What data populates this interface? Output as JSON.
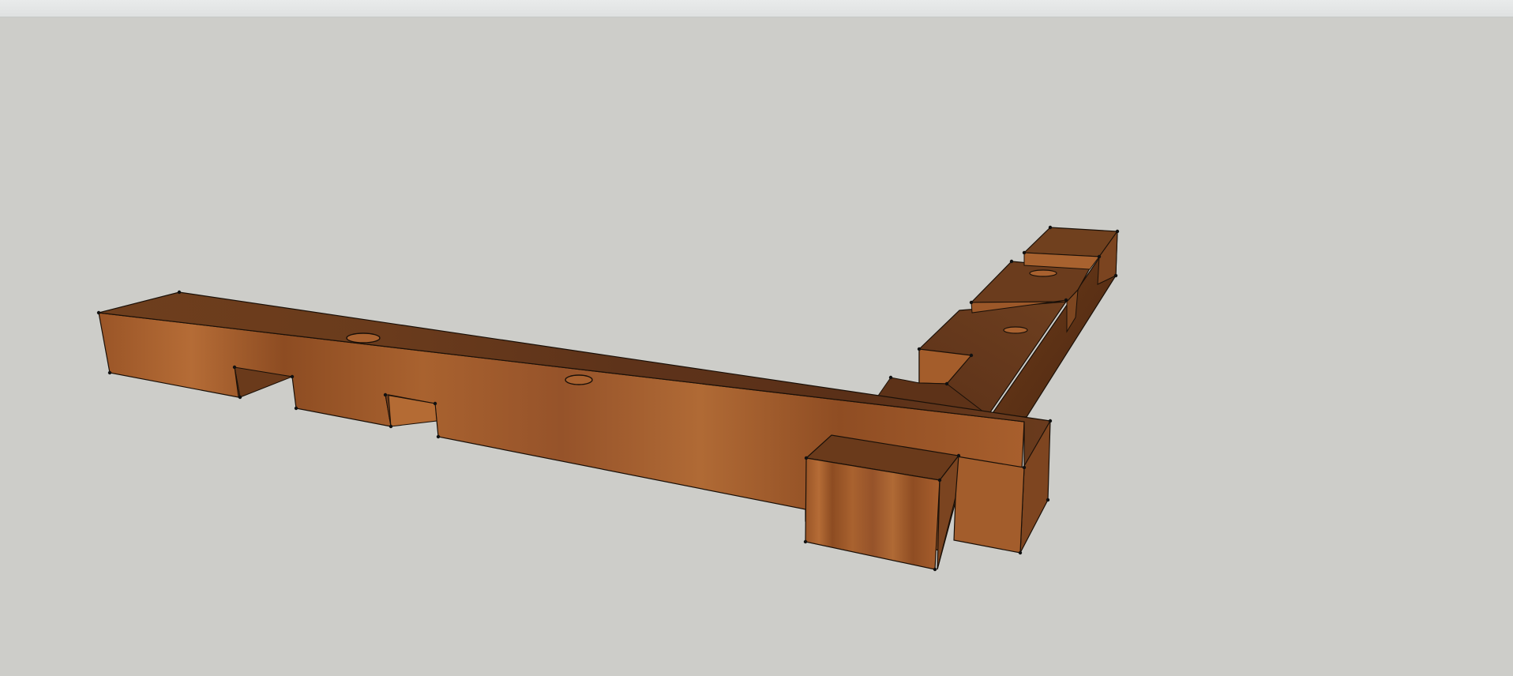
{
  "app": {
    "window_strip": "",
    "viewport_background": "#cdcdc9"
  },
  "model": {
    "material_colors": {
      "top": "#6a3b1c",
      "top_dark": "#5a3018",
      "side": "#9a5a2a",
      "side_light": "#b06a35",
      "side_dark": "#7d4620",
      "edge": "#1a1008"
    },
    "components": [
      "main-beam",
      "side-arm",
      "corner-block",
      "end-block",
      "notch-1",
      "notch-2",
      "hole-1",
      "hole-2",
      "hole-3",
      "hole-4"
    ]
  }
}
